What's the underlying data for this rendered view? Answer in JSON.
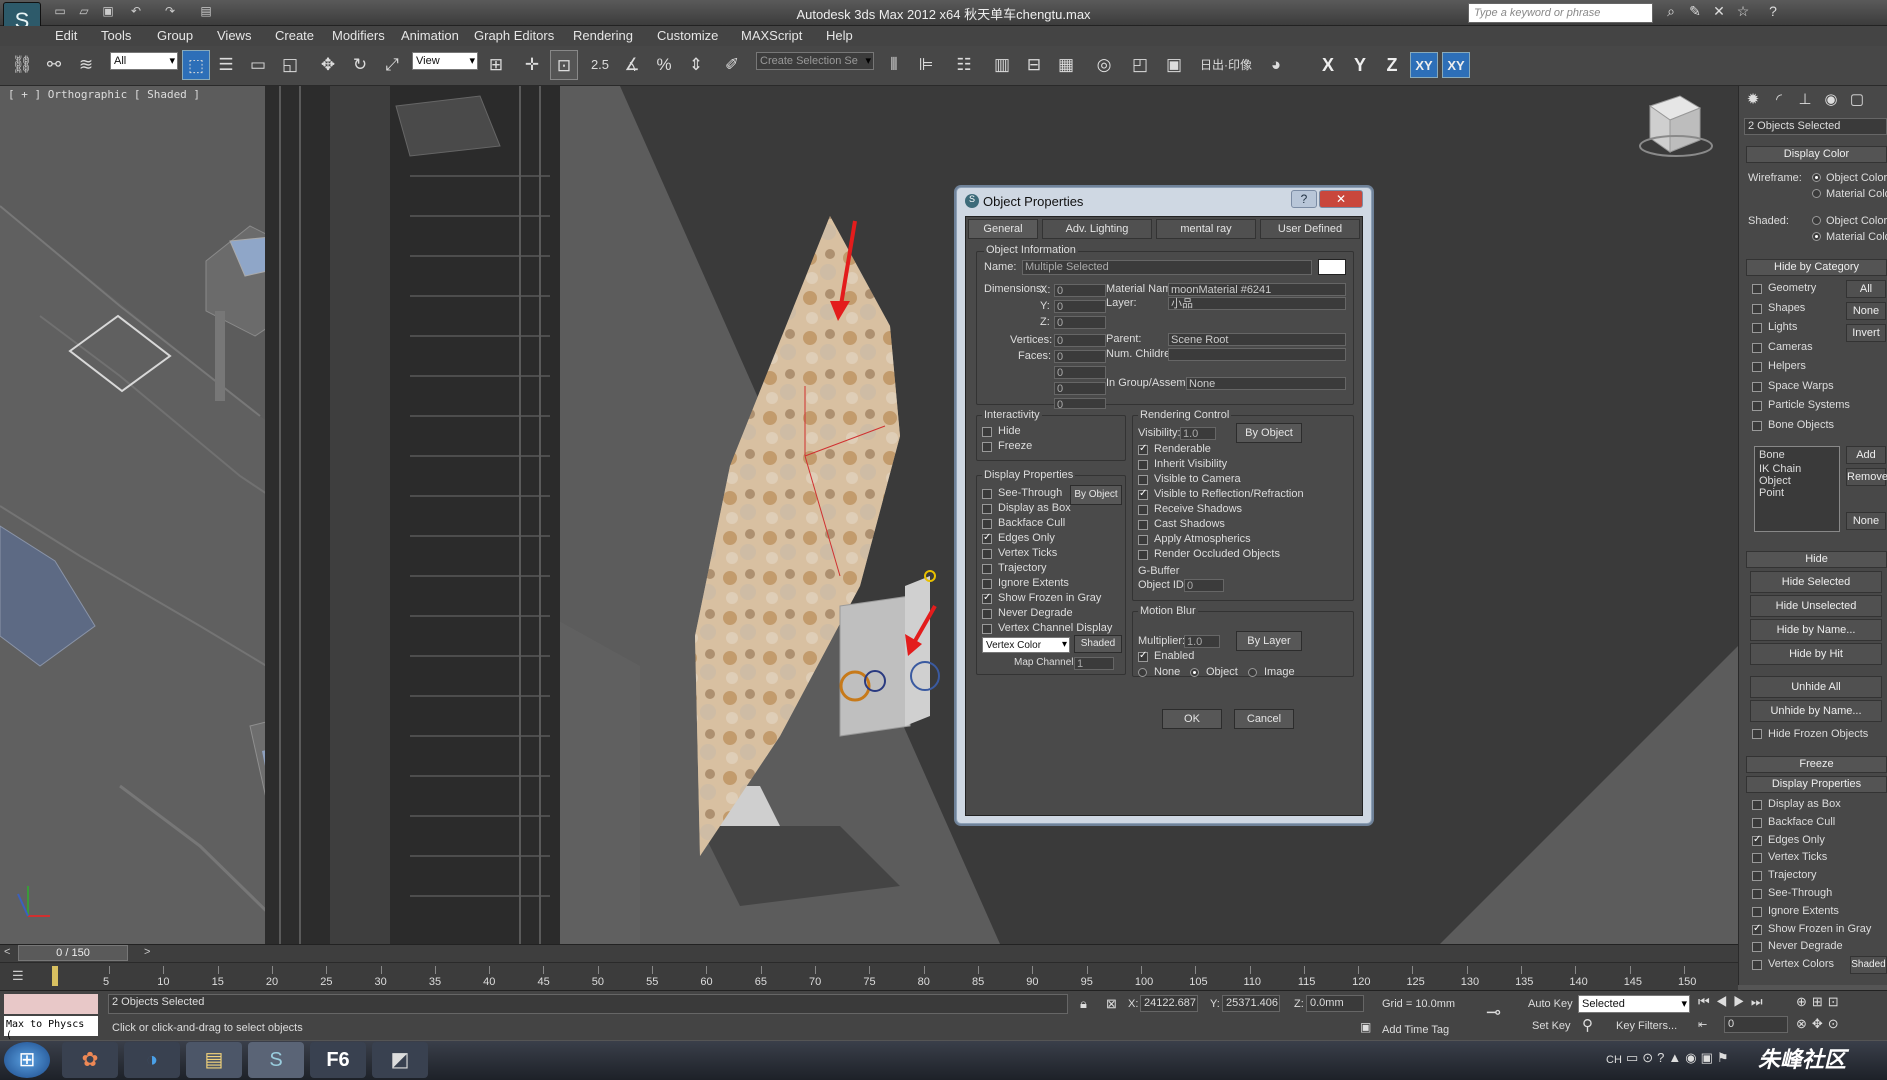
{
  "app": {
    "title": "Autodesk 3ds Max  2012 x64     秋天单车chengtu.max",
    "logo": "S",
    "search_placeholder": "Type a keyword or phrase",
    "watermark": "朱峰社区"
  },
  "menu": [
    "Edit",
    "Tools",
    "Group",
    "Views",
    "Create",
    "Modifiers",
    "Animation",
    "Graph Editors",
    "Rendering",
    "Customize",
    "MAXScript",
    "Help"
  ],
  "toolbar": {
    "filter_value": "All",
    "refcoord_value": "View",
    "selection_set_placeholder": "Create Selection Se",
    "snap_value": "2.5",
    "axes": [
      "X",
      "Y",
      "Z",
      "XY",
      "XY"
    ],
    "cn_button": "日出·印像"
  },
  "viewport": {
    "label": "[ + ] Orthographic [ Shaded ]"
  },
  "command_panel": {
    "selection_label": "2 Objects Selected",
    "display_color": {
      "header": "Display Color",
      "wireframe_label": "Wireframe:",
      "shaded_label": "Shaded:",
      "option1": "Object Color",
      "option2": "Material Color"
    },
    "hide_by_category": {
      "header": "Hide by Category",
      "items": [
        "Geometry",
        "Shapes",
        "Lights",
        "Cameras",
        "Helpers",
        "Space Warps",
        "Particle Systems",
        "Bone Objects"
      ],
      "buttons": [
        "All",
        "None",
        "Invert"
      ],
      "list_items": [
        "Bone",
        "IK Chain Object",
        "Point"
      ],
      "list_buttons": [
        "Add",
        "Remove",
        "None"
      ]
    },
    "hide": {
      "header": "Hide",
      "buttons": [
        "Hide Selected",
        "Hide Unselected",
        "Hide by Name...",
        "Hide by Hit",
        "Unhide All",
        "Unhide by Name..."
      ],
      "hide_frozen": "Hide Frozen Objects"
    },
    "freeze_header": "Freeze",
    "display_properties": {
      "header": "Display Properties",
      "items": [
        "Display as Box",
        "Backface Cull",
        "Edges Only",
        "Vertex Ticks",
        "Trajectory",
        "See-Through",
        "Ignore Extents",
        "Show Frozen in Gray",
        "Never Degrade",
        "Vertex Colors"
      ],
      "checked": [
        false,
        false,
        true,
        false,
        false,
        false,
        false,
        true,
        false,
        false
      ],
      "shaded_button": "Shaded"
    }
  },
  "dialog": {
    "title": "Object Properties",
    "help": "?",
    "close": "✕",
    "tabs": [
      "General",
      "Adv. Lighting",
      "mental ray",
      "User Defined"
    ],
    "object_info": {
      "header": "Object Information",
      "name_label": "Name:",
      "name_value": "Multiple Selected",
      "dimensions_label": "Dimensions:",
      "x_label": "X:",
      "y_label": "Y:",
      "z_label": "Z:",
      "dim_values": [
        "0",
        "0",
        "0"
      ],
      "vertices_label": "Vertices:",
      "faces_label": "Faces:",
      "vert_values": [
        "0",
        "0",
        "0",
        "0",
        "0"
      ],
      "material_label": "Material Name:",
      "material_value": "moonMaterial #6241",
      "layer_label": "Layer:",
      "layer_value": "小品",
      "parent_label": "Parent:",
      "parent_value": "Scene Root",
      "children_label": "Num. Children:",
      "children_value": "",
      "group_label": "In Group/Assembly:",
      "group_value": "None"
    },
    "interactivity": {
      "header": "Interactivity",
      "items": [
        "Hide",
        "Freeze"
      ]
    },
    "display_properties": {
      "header": "Display Properties",
      "by_object": "By Object",
      "items": [
        "See-Through",
        "Display as Box",
        "Backface Cull",
        "Edges Only",
        "Vertex Ticks",
        "Trajectory",
        "Ignore Extents",
        "Show Frozen in Gray",
        "Never Degrade",
        "Vertex Channel Display"
      ],
      "checked": [
        false,
        false,
        false,
        true,
        false,
        false,
        false,
        true,
        false,
        false
      ],
      "vertex_color": "Vertex Color",
      "shaded": "Shaded",
      "map_channel_label": "Map Channel:",
      "map_channel_value": "1"
    },
    "rendering_control": {
      "header": "Rendering Control",
      "visibility_label": "Visibility:",
      "visibility_value": "1.0",
      "by_object": "By Object",
      "items": [
        "Renderable",
        "Inherit Visibility",
        "Visible to Camera",
        "Visible to Reflection/Refraction",
        "Receive Shadows",
        "Cast Shadows",
        "Apply Atmospherics",
        "Render Occluded Objects"
      ],
      "checked": [
        true,
        false,
        false,
        true,
        false,
        false,
        false,
        false
      ],
      "gbuffer_header": "G-Buffer",
      "object_id_label": "Object ID:",
      "object_id_value": "0"
    },
    "motion_blur": {
      "header": "Motion Blur",
      "multiplier_label": "Multiplier:",
      "multiplier_value": "1.0",
      "by_layer": "By Layer",
      "enabled": "Enabled",
      "options": [
        "None",
        "Object",
        "Image"
      ]
    },
    "ok": "OK",
    "cancel": "Cancel"
  },
  "timeline": {
    "frame": "0 / 150",
    "ticks": [
      "5",
      "10",
      "15",
      "20",
      "25",
      "30",
      "35",
      "40",
      "45",
      "50",
      "55",
      "60",
      "65",
      "70",
      "75",
      "80",
      "85",
      "90",
      "95",
      "100",
      "105",
      "110",
      "115",
      "120",
      "125",
      "130",
      "135",
      "140",
      "145",
      "150"
    ]
  },
  "status": {
    "maxscript": "Max to Physcs (",
    "selected": "2 Objects Selected",
    "prompt": "Click or click-and-drag to select objects",
    "x_label": "X:",
    "x_value": "24122.687",
    "y_label": "Y:",
    "y_value": "25371.406",
    "z_label": "Z:",
    "z_value": "0.0mm",
    "grid": "Grid = 10.0mm",
    "add_time_tag": "Add Time Tag",
    "auto_key": "Auto Key",
    "selected_dd": "Selected",
    "set_key": "Set Key",
    "key_filters": "Key Filters...",
    "frame_value": "0"
  },
  "taskbar": {
    "lang": "CH"
  }
}
